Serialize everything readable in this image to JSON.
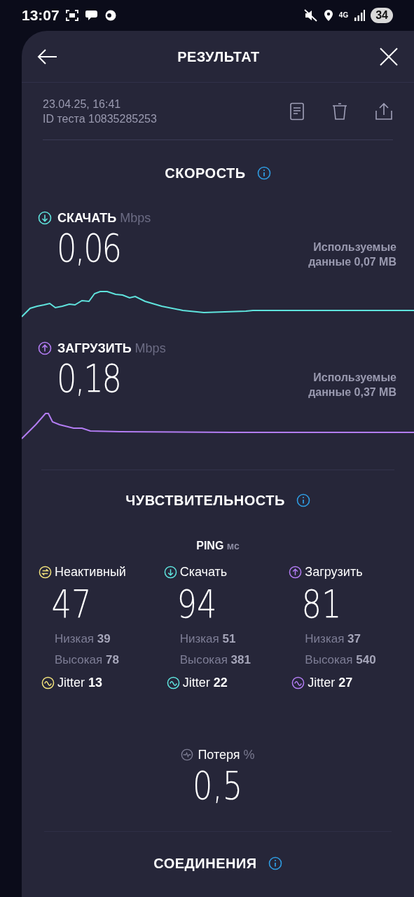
{
  "status_bar": {
    "time": "13:07",
    "network": "4G",
    "battery": "34"
  },
  "header": {
    "title": "РЕЗУЛЬТАТ"
  },
  "test": {
    "date": "23.04.25, 16:41",
    "id": "ID теста 10835285253"
  },
  "speed": {
    "title": "СКОРОСТЬ",
    "items": [
      {
        "kind": "download",
        "label": "СКАЧАТЬ",
        "unit": "Mbps",
        "value": "0,06",
        "data_used": "Используемые данные 0,07 MB",
        "color": "#5fe3dd"
      },
      {
        "kind": "upload",
        "label": "ЗАГРУЗИТЬ",
        "unit": "Mbps",
        "value": "0,18",
        "data_used": "Используемые данные 0,37 MB",
        "color": "#b27cf2"
      }
    ]
  },
  "latency": {
    "title": "ЧУВСТВИТЕЛЬНОСТЬ",
    "ping_label": "PING",
    "ping_unit": "мс",
    "columns": [
      {
        "kind": "idle",
        "label": "Неактивный",
        "value": "47",
        "low_label": "Низкая",
        "low": "39",
        "high_label": "Высокая",
        "high": "78",
        "jitter_label": "Jitter",
        "jitter": "13",
        "color": "#f2e27c"
      },
      {
        "kind": "download",
        "label": "Скачать",
        "value": "94",
        "low_label": "Низкая",
        "low": "51",
        "high_label": "Высокая",
        "high": "381",
        "jitter_label": "Jitter",
        "jitter": "22",
        "color": "#5fe3dd"
      },
      {
        "kind": "upload",
        "label": "Загрузить",
        "value": "81",
        "low_label": "Низкая",
        "low": "37",
        "high_label": "Высокая",
        "high": "540",
        "jitter_label": "Jitter",
        "jitter": "27",
        "color": "#b27cf2"
      }
    ]
  },
  "loss": {
    "label": "Потеря",
    "unit": "%",
    "value": "0,5"
  },
  "connections": {
    "title": "СОЕДИНЕНИЯ"
  }
}
